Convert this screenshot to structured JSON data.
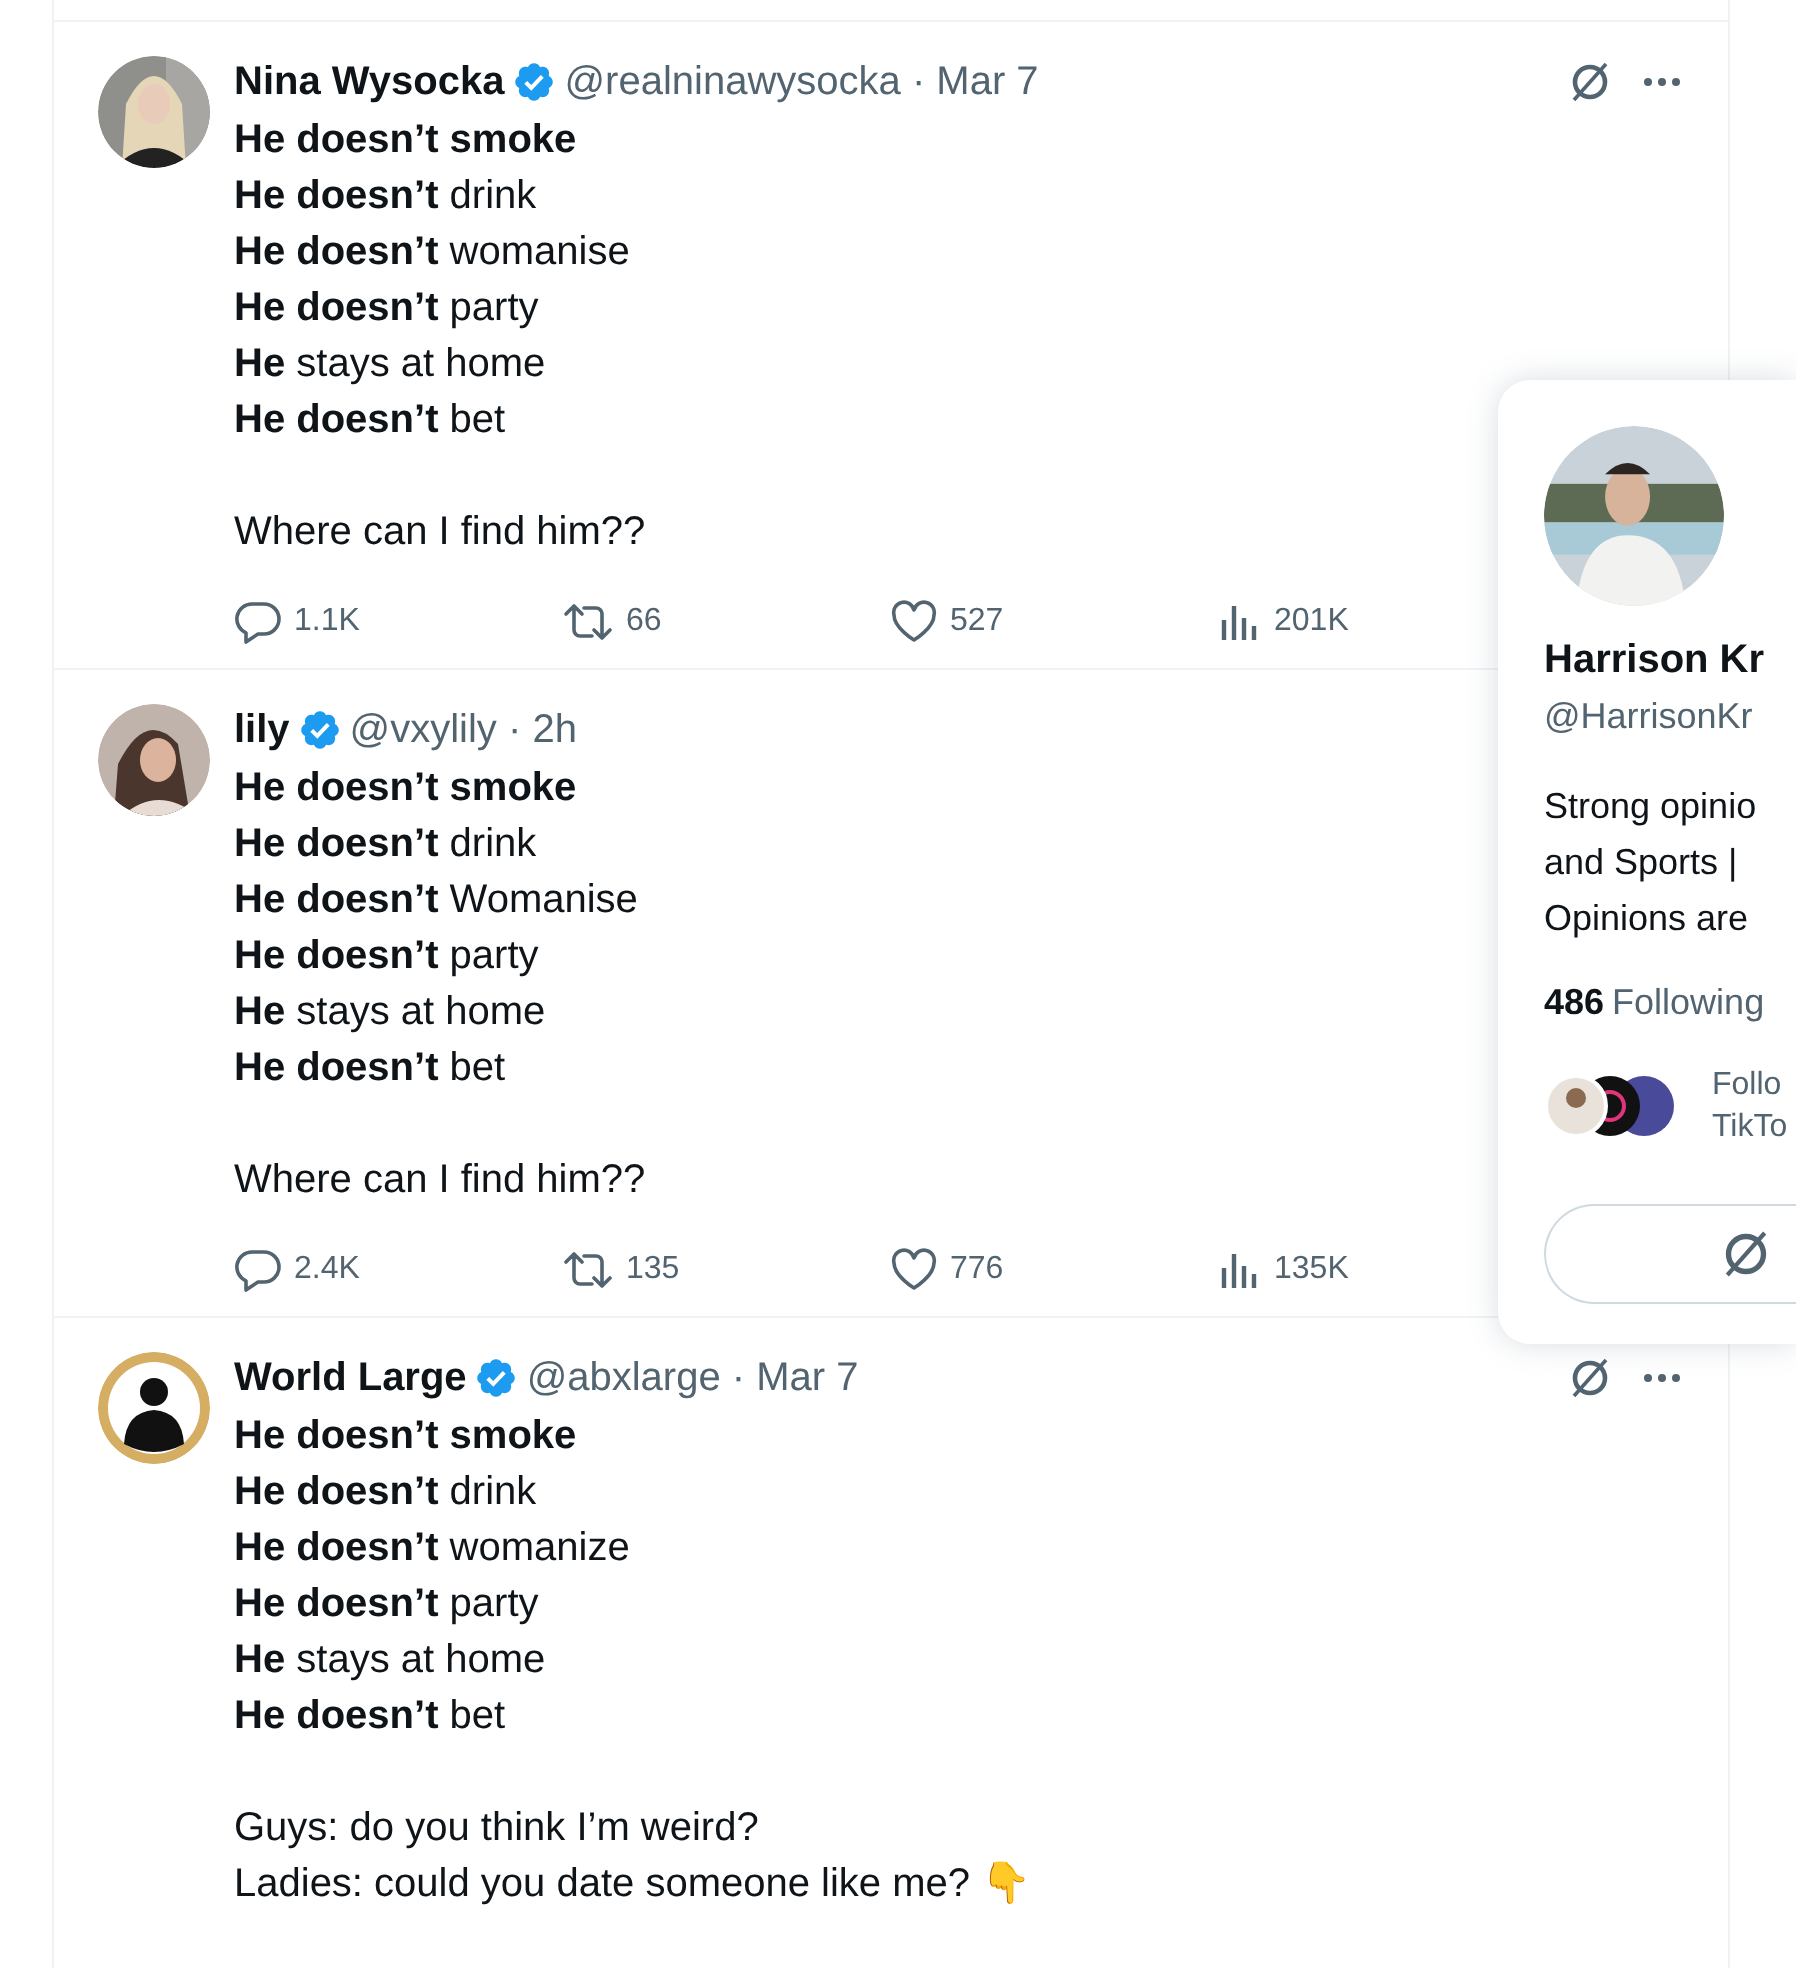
{
  "tweets": [
    {
      "name": "Nina Wysocka",
      "verified": true,
      "meta": "@realninawysocka · Mar 7",
      "menu_icons": true,
      "paragraphs": [
        [
          "**He doesn’t smoke**",
          "**He doesn’t** drink",
          "**He doesn’t** womanise",
          "**He doesn’t** party",
          "**He** stays at home",
          "**He doesn’t** bet"
        ],
        [
          "Where can I find him??"
        ]
      ],
      "actions": {
        "replies": "1.1K",
        "reposts": "66",
        "likes": "527",
        "views": "201K"
      }
    },
    {
      "name": "lily",
      "verified": true,
      "meta": "@vxylily · 2h",
      "menu_icons": false,
      "paragraphs": [
        [
          "**He doesn’t smoke**",
          "**He doesn’t** drink",
          "**He doesn’t** Womanise",
          "**He doesn’t** party",
          "**He** stays at home",
          "**He doesn’t** bet"
        ],
        [
          "Where can I find him??"
        ]
      ],
      "actions": {
        "replies": "2.4K",
        "reposts": "135",
        "likes": "776",
        "views": "135K"
      }
    },
    {
      "name": "World Large",
      "verified": true,
      "meta": "@abxlarge · Mar 7",
      "menu_icons": true,
      "paragraphs": [
        [
          "**He doesn’t smoke**",
          "**He doesn’t** drink",
          "**He doesn’t** womanize",
          "**He doesn’t** party",
          "**He** stays at home",
          "**He doesn’t** bet"
        ],
        [
          "Guys: do you think I’m weird?",
          "Ladies: could you date someone like me? 👇"
        ]
      ]
    }
  ],
  "hover_card": {
    "name": "Harrison Kr",
    "handle": "@HarrisonKr",
    "bio": [
      "Strong opinio",
      "and Sports |",
      "Opinions are"
    ],
    "following_count": "486",
    "following_label": "Following",
    "followed_by": [
      "Follo",
      "TikTo"
    ]
  }
}
